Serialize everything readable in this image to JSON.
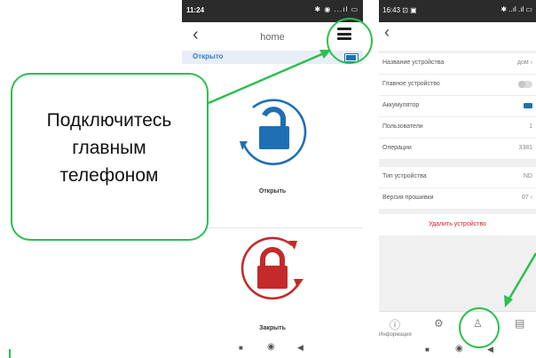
{
  "callout": {
    "text_line1": "Подключитесь",
    "text_line2": "главным",
    "text_line3": "телефоном"
  },
  "colors": {
    "accent_green": "#2bc04f",
    "lock_blue": "#1f6fb5",
    "lock_red": "#c42a2a"
  },
  "left_phone": {
    "status_time": "11:24",
    "status_icons": "✱ ◉ ...ıl ▭",
    "back_icon": "chevron-left-icon",
    "title": "home",
    "menu_icon": "hamburger-menu-icon",
    "lock_state": "Открыто",
    "battery_icon": "battery-icon",
    "unlock_label": "Открыть",
    "lock_label": "Закрыть"
  },
  "right_phone": {
    "status_time": "16:43 ⊡ ▣",
    "status_icons": "✱ ..ıl .ıl ▭",
    "rows": [
      {
        "label": "Название устройства",
        "value": "дом ›"
      },
      {
        "label": "Главное устройство",
        "value": ""
      },
      {
        "label": "Аккумулятор",
        "value": ""
      },
      {
        "label": "Пользователи",
        "value": "1"
      },
      {
        "label": "Операции",
        "value": "3381"
      },
      {
        "label": "Тип устройства",
        "value": "ND"
      },
      {
        "label": "Версия прошивки",
        "value": "07 ›"
      }
    ],
    "delete_label": "Удалить устройство",
    "tabs": [
      {
        "icon": "info-icon",
        "label": "Информация"
      },
      {
        "icon": "settings-icon",
        "label": ""
      },
      {
        "icon": "user-icon",
        "label": ""
      },
      {
        "icon": "clipboard-icon",
        "label": ""
      }
    ]
  }
}
